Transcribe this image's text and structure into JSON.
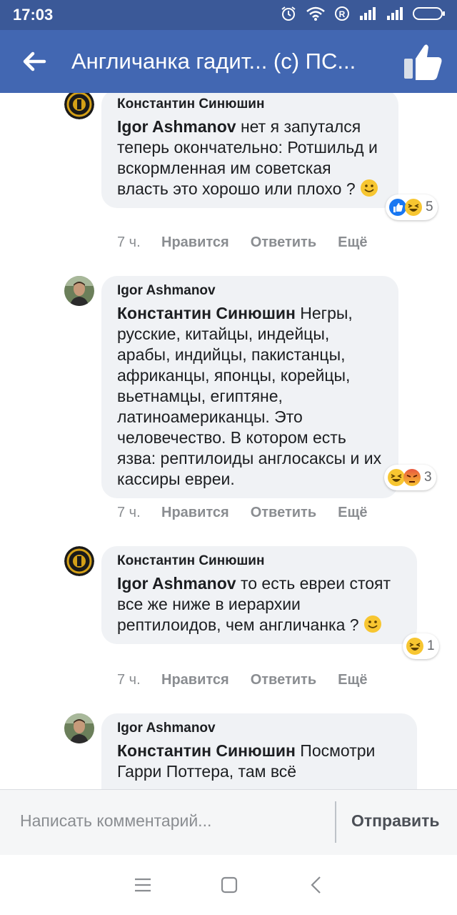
{
  "status_bar": {
    "time": "17:03",
    "icons": [
      "alarm-icon",
      "wifi-icon",
      "roaming-icon",
      "signal-icon",
      "signal-icon",
      "battery-icon"
    ]
  },
  "header": {
    "back_icon": "back-arrow-icon",
    "title": "Англичанка гадит... (с) ПС...",
    "like_icon": "thumbs-up-icon"
  },
  "comments": [
    {
      "author": "Константин Синюшин",
      "mention": "Igor Ashmanov",
      "text": "нет я запутался теперь окончательно: Ротшильд и вскормленная им советская власть это хорошо или плохо ?",
      "emoji": "smile-icon",
      "time": "7 ч.",
      "like_label": "Нравится",
      "reply_label": "Ответить",
      "more_label": "Ещё",
      "reactions": [
        "like-icon",
        "haha-icon"
      ],
      "reaction_count": "5"
    },
    {
      "author": "Igor Ashmanov",
      "mention": "Константин Синюшин",
      "text": "Негры, русские, китайцы, индейцы, арабы, индийцы, пакистанцы, африканцы, японцы, корейцы, вьетнамцы, египтяне, латиноамериканцы. Это человечество. В котором есть язва: рептилоиды англосаксы и их кассиры евреи.",
      "time": "7 ч.",
      "like_label": "Нравится",
      "reply_label": "Ответить",
      "more_label": "Ещё",
      "reactions": [
        "haha-icon",
        "angry-icon"
      ],
      "reaction_count": "3"
    },
    {
      "author": "Константин Синюшин",
      "mention": "Igor Ashmanov",
      "text": "то есть евреи стоят все же ниже в иерархии рептилоидов, чем англичанка ?",
      "emoji": "smile-icon",
      "time": "7 ч.",
      "like_label": "Нравится",
      "reply_label": "Ответить",
      "more_label": "Ещё",
      "reactions": [
        "haha-icon"
      ],
      "reaction_count": "1"
    },
    {
      "author": "Igor Ashmanov",
      "mention": "Константин Синюшин",
      "text": "Посмотри Гарри Поттера, там всё"
    }
  ],
  "composer": {
    "placeholder": "Написать комментарий...",
    "send_label": "Отправить"
  },
  "nav_bar": {
    "icons": [
      "menu-icon",
      "home-square-icon",
      "back-chevron-icon"
    ]
  },
  "colors": {
    "status_bar": "#3b5998",
    "app_bar": "#4267b2",
    "bubble": "#f0f2f5",
    "secondary_text": "#8a8d91"
  }
}
